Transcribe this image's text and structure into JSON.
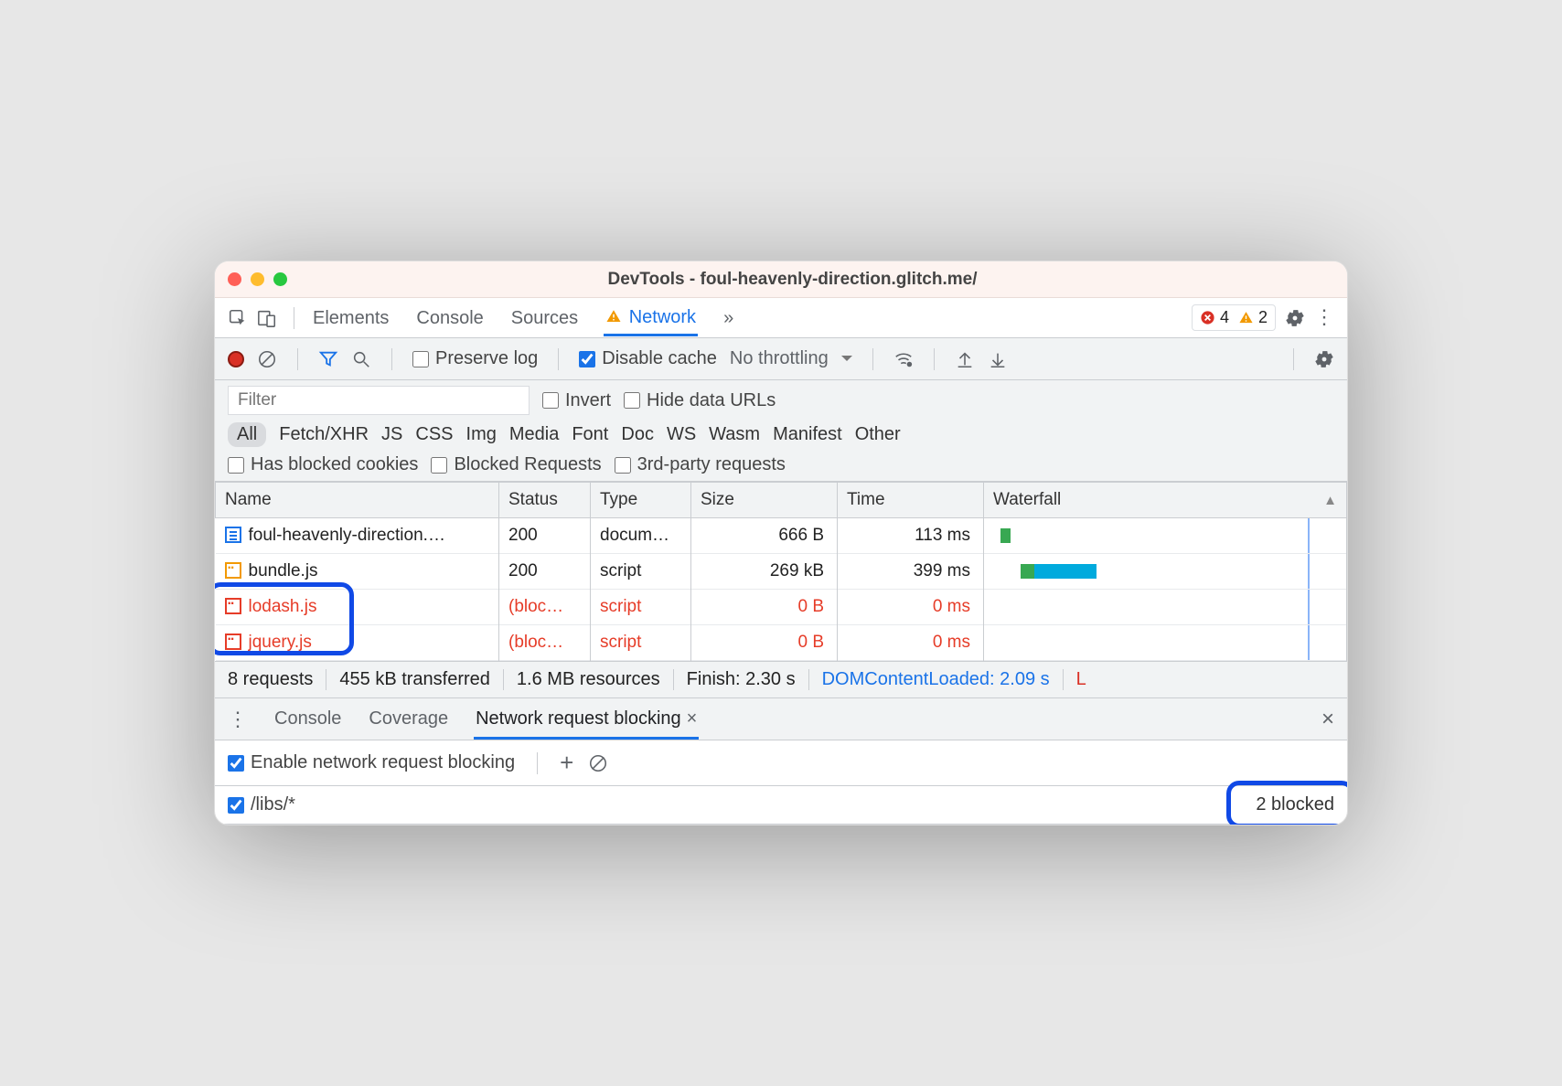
{
  "window_title": "DevTools - foul-heavenly-direction.glitch.me/",
  "main_tabs": {
    "elements": "Elements",
    "console": "Console",
    "sources": "Sources",
    "network": "Network",
    "overflow": "»"
  },
  "error_count": "4",
  "warn_count": "2",
  "toolbar": {
    "preserve_log": "Preserve log",
    "disable_cache": "Disable cache",
    "throttling": "No throttling"
  },
  "filter": {
    "placeholder": "Filter",
    "invert": "Invert",
    "hide_data_urls": "Hide data URLs"
  },
  "types": [
    "All",
    "Fetch/XHR",
    "JS",
    "CSS",
    "Img",
    "Media",
    "Font",
    "Doc",
    "WS",
    "Wasm",
    "Manifest",
    "Other"
  ],
  "flags": {
    "blocked_cookies": "Has blocked cookies",
    "blocked_requests": "Blocked Requests",
    "third_party": "3rd-party requests"
  },
  "columns": {
    "name": "Name",
    "status": "Status",
    "type": "Type",
    "size": "Size",
    "time": "Time",
    "waterfall": "Waterfall"
  },
  "rows": [
    {
      "icon": "doc",
      "name": "foul-heavenly-direction.…",
      "status": "200",
      "type": "docum…",
      "size": "666 B",
      "time": "113 ms",
      "blocked": false,
      "wf": [
        {
          "c": "g",
          "l": 2,
          "w": 3
        }
      ]
    },
    {
      "icon": "js",
      "name": "bundle.js",
      "status": "200",
      "type": "script",
      "size": "269 kB",
      "time": "399 ms",
      "blocked": false,
      "wf": [
        {
          "c": "g",
          "l": 8,
          "w": 4
        },
        {
          "c": "b",
          "l": 12,
          "w": 18
        }
      ]
    },
    {
      "icon": "jsb",
      "name": "lodash.js",
      "status": "(bloc…",
      "type": "script",
      "size": "0 B",
      "time": "0 ms",
      "blocked": true,
      "wf": []
    },
    {
      "icon": "jsb",
      "name": "jquery.js",
      "status": "(bloc…",
      "type": "script",
      "size": "0 B",
      "time": "0 ms",
      "blocked": true,
      "wf": []
    }
  ],
  "summary": {
    "requests": "8 requests",
    "transferred": "455 kB transferred",
    "resources": "1.6 MB resources",
    "finish": "Finish: 2.30 s",
    "dcl": "DOMContentLoaded: 2.09 s",
    "load": "L"
  },
  "drawer": {
    "console": "Console",
    "coverage": "Coverage",
    "blocking": "Network request blocking",
    "enable_label": "Enable network request blocking",
    "pattern": "/libs/*",
    "blocked_count": "2 blocked"
  }
}
